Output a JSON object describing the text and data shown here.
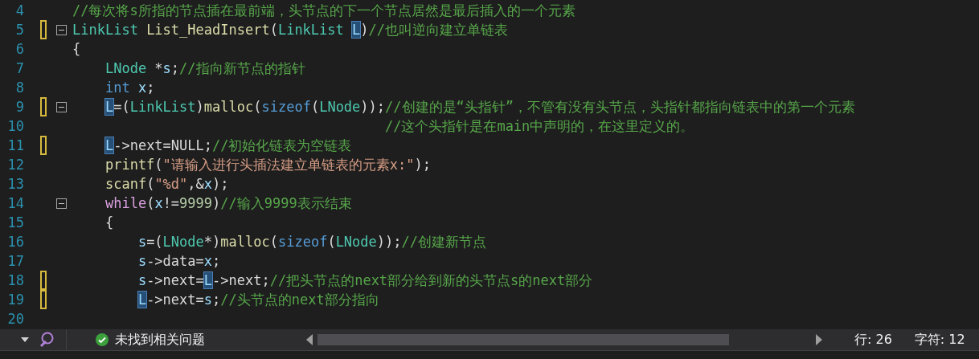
{
  "editor": {
    "lines": [
      {
        "number": "4",
        "changed": false,
        "fold": false,
        "tokens": [
          {
            "kind": "comment",
            "text": "//每次将s所指的节点插在最前端，头节点的下一个节点居然是最后插入的一个元素"
          }
        ]
      },
      {
        "number": "5",
        "changed": true,
        "fold": true,
        "tokens": [
          {
            "kind": "type",
            "text": "LinkList"
          },
          {
            "kind": "func",
            "text": "List_HeadInsert",
            "spaced": true
          },
          {
            "kind": "plain",
            "text": "("
          },
          {
            "kind": "type",
            "text": "LinkList"
          },
          {
            "kind": "ref",
            "text": "L",
            "spaced": true
          },
          {
            "kind": "plain",
            "text": ")"
          },
          {
            "kind": "comment",
            "text": "//也叫逆向建立单链表"
          }
        ]
      },
      {
        "number": "6",
        "changed": false,
        "fold": false,
        "tokens": [
          {
            "kind": "plain",
            "text": "{"
          }
        ],
        "children": [
          {
            "number": "7",
            "changed": false,
            "fold": false,
            "tokens": [
              {
                "kind": "type",
                "text": "LNode"
              },
              {
                "kind": "plain",
                "text": "*",
                "spaced": true
              },
              {
                "kind": "param",
                "text": "s"
              },
              {
                "kind": "plain",
                "text": ";"
              },
              {
                "kind": "comment",
                "text": "//指向新节点的指针"
              }
            ]
          },
          {
            "number": "8",
            "changed": false,
            "fold": false,
            "tokens": [
              {
                "kind": "keyword",
                "text": "int"
              },
              {
                "kind": "param",
                "text": "x",
                "spaced": true
              },
              {
                "kind": "plain",
                "text": ";"
              }
            ]
          },
          {
            "number": "9",
            "changed": true,
            "fold": true,
            "tokens": [
              {
                "kind": "ref",
                "text": "L"
              },
              {
                "kind": "plain",
                "text": "=("
              },
              {
                "kind": "type",
                "text": "LinkList"
              },
              {
                "kind": "plain",
                "text": ")"
              },
              {
                "kind": "func",
                "text": "malloc"
              },
              {
                "kind": "plain",
                "text": "("
              },
              {
                "kind": "keyword",
                "text": "sizeof"
              },
              {
                "kind": "plain",
                "text": "("
              },
              {
                "kind": "type",
                "text": "LNode"
              },
              {
                "kind": "plain",
                "text": "));"
              },
              {
                "kind": "comment",
                "text": "//创建的是“头指针”，不管有没有头节点，头指针都指向链表中的第一个元素"
              }
            ]
          },
          {
            "number": "10",
            "kind": "continuation",
            "changed": false,
            "fold": false,
            "tokens": [
              {
                "kind": "comment",
                "text": "//这个头指针是在main中声明的，在这里定义的。"
              }
            ]
          },
          {
            "number": "11",
            "changed": true,
            "fold": false,
            "tokens": [
              {
                "kind": "ref",
                "text": "L"
              },
              {
                "kind": "plain",
                "text": "->next=NULL;"
              },
              {
                "kind": "comment",
                "text": "//初始化链表为空链表"
              }
            ]
          },
          {
            "number": "12",
            "changed": false,
            "fold": false,
            "tokens": [
              {
                "kind": "func",
                "text": "printf"
              },
              {
                "kind": "plain",
                "text": "("
              },
              {
                "kind": "string",
                "text": "\"请输入进行头插法建立单链表的元素x:\""
              },
              {
                "kind": "plain",
                "text": ");"
              }
            ]
          },
          {
            "number": "13",
            "changed": false,
            "fold": false,
            "tokens": [
              {
                "kind": "func",
                "text": "scanf"
              },
              {
                "kind": "plain",
                "text": "("
              },
              {
                "kind": "string",
                "text": "\"%d\""
              },
              {
                "kind": "plain",
                "text": ",&"
              },
              {
                "kind": "param",
                "text": "x"
              },
              {
                "kind": "plain",
                "text": ");"
              }
            ]
          },
          {
            "number": "14",
            "changed": false,
            "fold": true,
            "tokens": [
              {
                "kind": "control",
                "text": "while"
              },
              {
                "kind": "plain",
                "text": "("
              },
              {
                "kind": "param",
                "text": "x"
              },
              {
                "kind": "plain",
                "text": "!="
              },
              {
                "kind": "number",
                "text": "9999"
              },
              {
                "kind": "plain",
                "text": ")"
              },
              {
                "kind": "comment",
                "text": "//输入9999表示结束"
              }
            ]
          },
          {
            "number": "15",
            "changed": false,
            "fold": false,
            "tokens": [
              {
                "kind": "plain",
                "text": "{"
              }
            ],
            "children": [
              {
                "number": "16",
                "changed": false,
                "fold": false,
                "tokens": [
                  {
                    "kind": "param",
                    "text": "s"
                  },
                  {
                    "kind": "plain",
                    "text": "=("
                  },
                  {
                    "kind": "type",
                    "text": "LNode"
                  },
                  {
                    "kind": "plain",
                    "text": "*)"
                  },
                  {
                    "kind": "func",
                    "text": "malloc"
                  },
                  {
                    "kind": "plain",
                    "text": "("
                  },
                  {
                    "kind": "keyword",
                    "text": "sizeof"
                  },
                  {
                    "kind": "plain",
                    "text": "("
                  },
                  {
                    "kind": "type",
                    "text": "LNode"
                  },
                  {
                    "kind": "plain",
                    "text": "));"
                  },
                  {
                    "kind": "comment",
                    "text": "//创建新节点"
                  }
                ]
              },
              {
                "number": "17",
                "changed": false,
                "fold": false,
                "tokens": [
                  {
                    "kind": "param",
                    "text": "s"
                  },
                  {
                    "kind": "plain",
                    "text": "->data="
                  },
                  {
                    "kind": "param",
                    "text": "x"
                  },
                  {
                    "kind": "plain",
                    "text": ";"
                  }
                ]
              },
              {
                "number": "18",
                "changed": true,
                "fold": false,
                "tokens": [
                  {
                    "kind": "param",
                    "text": "s"
                  },
                  {
                    "kind": "plain",
                    "text": "->next="
                  },
                  {
                    "kind": "ref",
                    "text": "L"
                  },
                  {
                    "kind": "plain",
                    "text": "->next;"
                  },
                  {
                    "kind": "comment",
                    "text": "//把头节点的next部分给到新的头节点s的next部分"
                  }
                ]
              },
              {
                "number": "19",
                "changed": true,
                "fold": false,
                "tokens": [
                  {
                    "kind": "ref",
                    "text": "L"
                  },
                  {
                    "kind": "plain",
                    "text": "->next="
                  },
                  {
                    "kind": "param",
                    "text": "s"
                  },
                  {
                    "kind": "plain",
                    "text": ";"
                  },
                  {
                    "kind": "comment",
                    "text": "//头节点的next部分指向"
                  }
                ]
              }
            ]
          }
        ]
      },
      {
        "number": "20",
        "changed": false,
        "fold": false
      }
    ]
  },
  "status_bar": {
    "message": "未找到相关问题",
    "line": "行: 26",
    "char": "字符: 12"
  }
}
